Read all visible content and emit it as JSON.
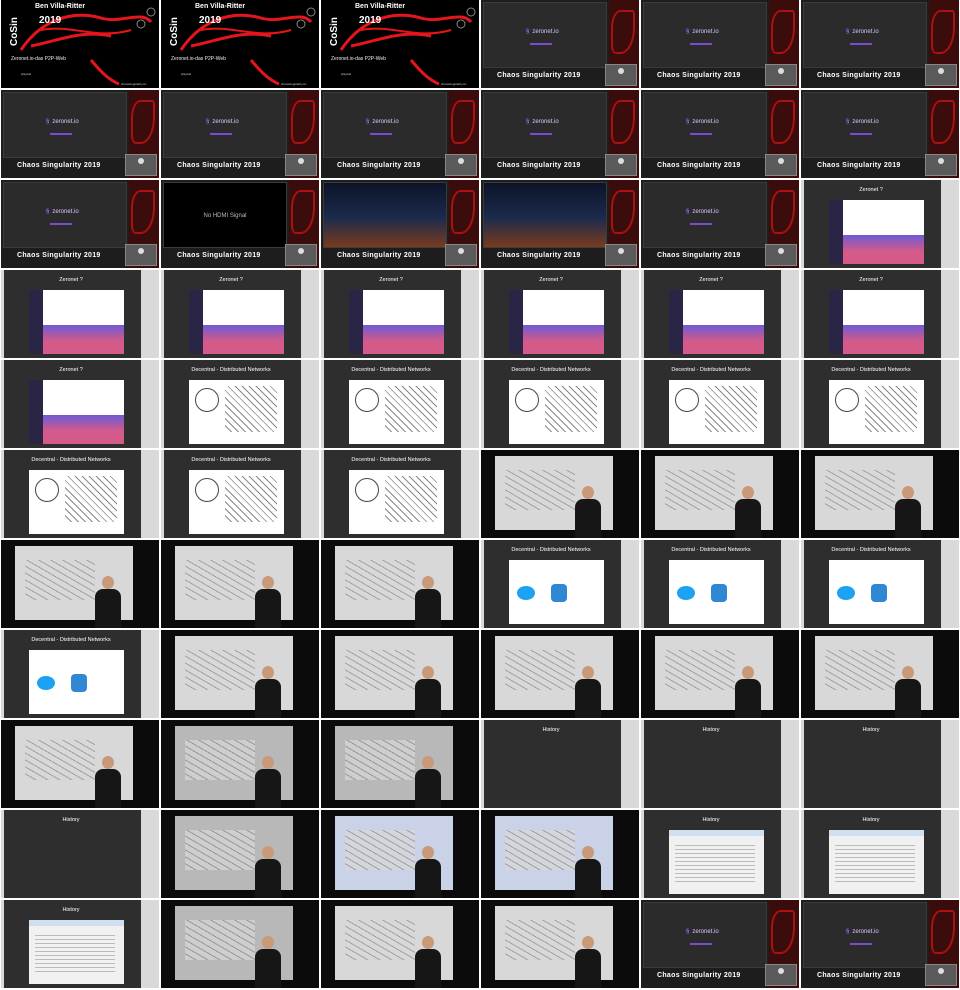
{
  "title_card": {
    "name": "Ben Villa-Ritter",
    "event_short": "CoSin",
    "year": "2019",
    "subtitle": "Zeronet.io-das P2P-Web",
    "footer_left": "playstel",
    "footer_right": "chaossingularity.sn"
  },
  "chaos": {
    "brand": "Chaos Singularity 2019",
    "logo_text": "zeronet.io",
    "no_signal": "No HDMI Signal"
  },
  "headings": {
    "zeronet": "Zeronet ?",
    "decentral": "Decentral - Distributed Networks",
    "history": "History"
  },
  "tiles": [
    {
      "t": "title"
    },
    {
      "t": "title"
    },
    {
      "t": "title"
    },
    {
      "t": "chaos",
      "s": "logo"
    },
    {
      "t": "chaos",
      "s": "logo"
    },
    {
      "t": "chaos",
      "s": "logo"
    },
    {
      "t": "chaos",
      "s": "logo"
    },
    {
      "t": "chaos",
      "s": "logo"
    },
    {
      "t": "chaos",
      "s": "logo"
    },
    {
      "t": "chaos",
      "s": "logo"
    },
    {
      "t": "chaos",
      "s": "logo"
    },
    {
      "t": "chaos",
      "s": "logo"
    },
    {
      "t": "chaos",
      "s": "logo"
    },
    {
      "t": "chaos",
      "s": "nosignal"
    },
    {
      "t": "chaos",
      "s": "night"
    },
    {
      "t": "chaos",
      "s": "night"
    },
    {
      "t": "chaos",
      "s": "logo"
    },
    {
      "t": "slide",
      "h": "zeronet",
      "c": "zero"
    },
    {
      "t": "slide",
      "h": "zeronet",
      "c": "zero"
    },
    {
      "t": "slide",
      "h": "zeronet",
      "c": "zero"
    },
    {
      "t": "slide",
      "h": "zeronet",
      "c": "zero"
    },
    {
      "t": "slide",
      "h": "zeronet",
      "c": "zero"
    },
    {
      "t": "slide",
      "h": "zeronet",
      "c": "zero"
    },
    {
      "t": "slide",
      "h": "zeronet",
      "c": "zero"
    },
    {
      "t": "slide",
      "h": "zeronet",
      "c": "zero"
    },
    {
      "t": "slide",
      "h": "decentral",
      "c": "net"
    },
    {
      "t": "slide",
      "h": "decentral",
      "c": "net"
    },
    {
      "t": "slide",
      "h": "decentral",
      "c": "net"
    },
    {
      "t": "slide",
      "h": "decentral",
      "c": "net"
    },
    {
      "t": "slide",
      "h": "decentral",
      "c": "net"
    },
    {
      "t": "slide",
      "h": "decentral",
      "c": "net"
    },
    {
      "t": "slide",
      "h": "decentral",
      "c": "net"
    },
    {
      "t": "slide",
      "h": "decentral",
      "c": "net"
    },
    {
      "t": "photo",
      "p": "light"
    },
    {
      "t": "photo",
      "p": "light"
    },
    {
      "t": "photo",
      "p": "light"
    },
    {
      "t": "photo",
      "p": "light"
    },
    {
      "t": "photo",
      "p": "light"
    },
    {
      "t": "photo",
      "p": "light"
    },
    {
      "t": "slide",
      "h": "decentral",
      "c": "logos"
    },
    {
      "t": "slide",
      "h": "decentral",
      "c": "logos"
    },
    {
      "t": "slide",
      "h": "decentral",
      "c": "logos"
    },
    {
      "t": "slide",
      "h": "decentral",
      "c": "logos"
    },
    {
      "t": "photo",
      "p": "light"
    },
    {
      "t": "photo",
      "p": "light"
    },
    {
      "t": "photo",
      "p": "light"
    },
    {
      "t": "photo",
      "p": "light"
    },
    {
      "t": "photo",
      "p": "light"
    },
    {
      "t": "photo",
      "p": "light"
    },
    {
      "t": "photo",
      "p": "grey"
    },
    {
      "t": "photo",
      "p": "grey"
    },
    {
      "t": "slide",
      "h": "history",
      "c": "none"
    },
    {
      "t": "slide",
      "h": "history",
      "c": "none"
    },
    {
      "t": "slide",
      "h": "history",
      "c": "none"
    },
    {
      "t": "slide",
      "h": "history",
      "c": "none"
    },
    {
      "t": "photo",
      "p": "grey"
    },
    {
      "t": "photo",
      "p": "blue"
    },
    {
      "t": "photo",
      "p": "blue"
    },
    {
      "t": "slide",
      "h": "history",
      "c": "hist"
    },
    {
      "t": "slide",
      "h": "history",
      "c": "hist"
    },
    {
      "t": "slide",
      "h": "history",
      "c": "hist"
    },
    {
      "t": "photo",
      "p": "grey"
    },
    {
      "t": "photo",
      "p": "light"
    },
    {
      "t": "photo",
      "p": "light"
    },
    {
      "t": "chaos",
      "s": "logo"
    },
    {
      "t": "chaos",
      "s": "logo"
    }
  ]
}
